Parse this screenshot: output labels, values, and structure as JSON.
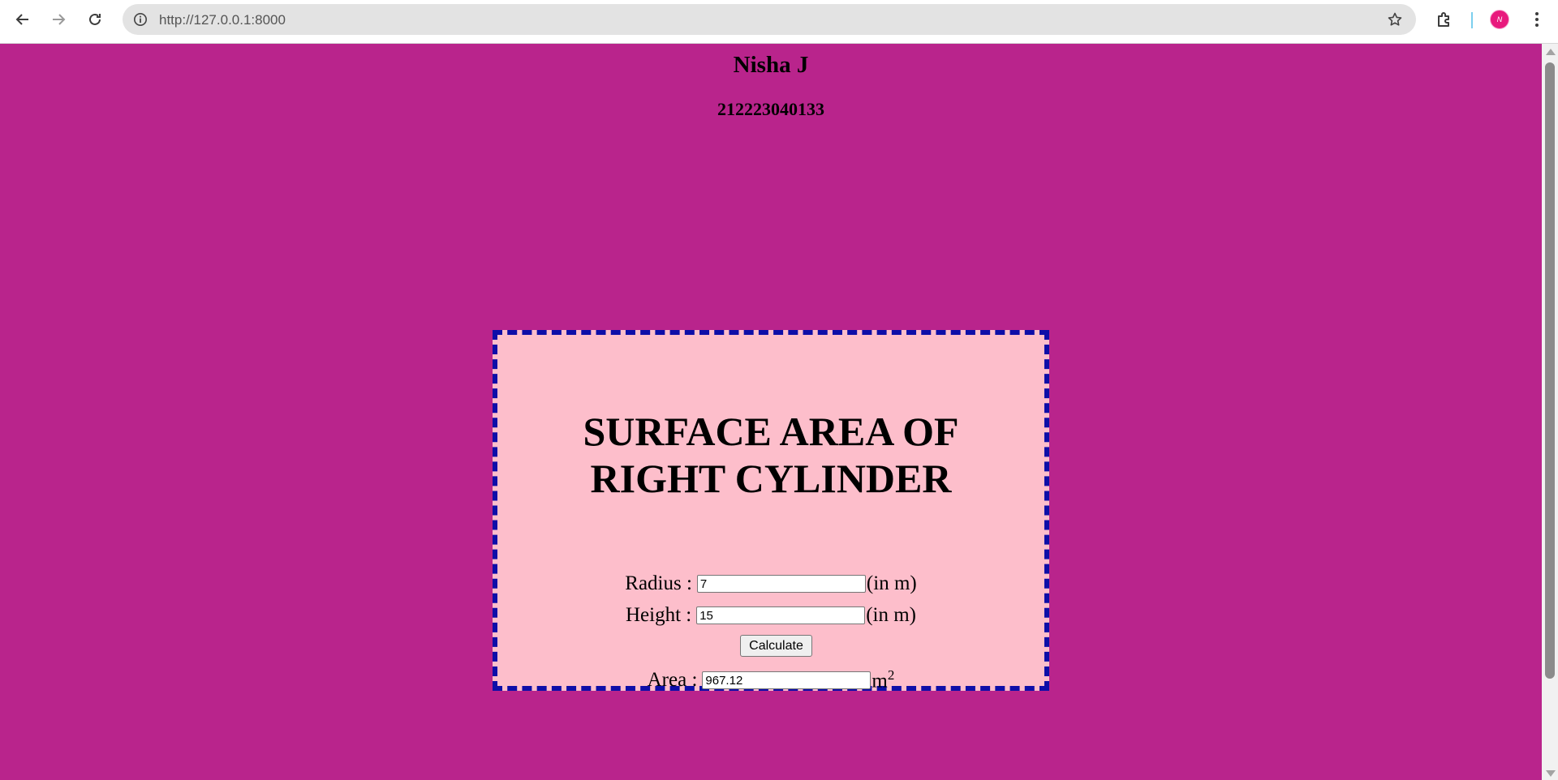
{
  "browser": {
    "url": "http://127.0.0.1:8000",
    "avatar_letter": "N",
    "icons": [
      "back-icon",
      "forward-icon",
      "reload-icon",
      "info-icon",
      "star-icon",
      "extensions-icon",
      "menu-icon"
    ]
  },
  "header": {
    "name": "Nisha J",
    "register_number": "212223040133"
  },
  "card": {
    "title_line1": "SURFACE AREA OF",
    "title_line2": "RIGHT CYLINDER",
    "radius_label": "Radius :",
    "radius_value": "7",
    "radius_unit": "(in m)",
    "height_label": "Height :",
    "height_value": "15",
    "height_unit": "(in m)",
    "calculate_label": "Calculate",
    "area_label": "Area :",
    "area_value": "967.12",
    "area_unit": "m",
    "area_unit_exponent": "2"
  },
  "colors": {
    "page_background": "#b9248c",
    "card_background": "#fdbecb",
    "card_border": "#0e0ea8"
  }
}
